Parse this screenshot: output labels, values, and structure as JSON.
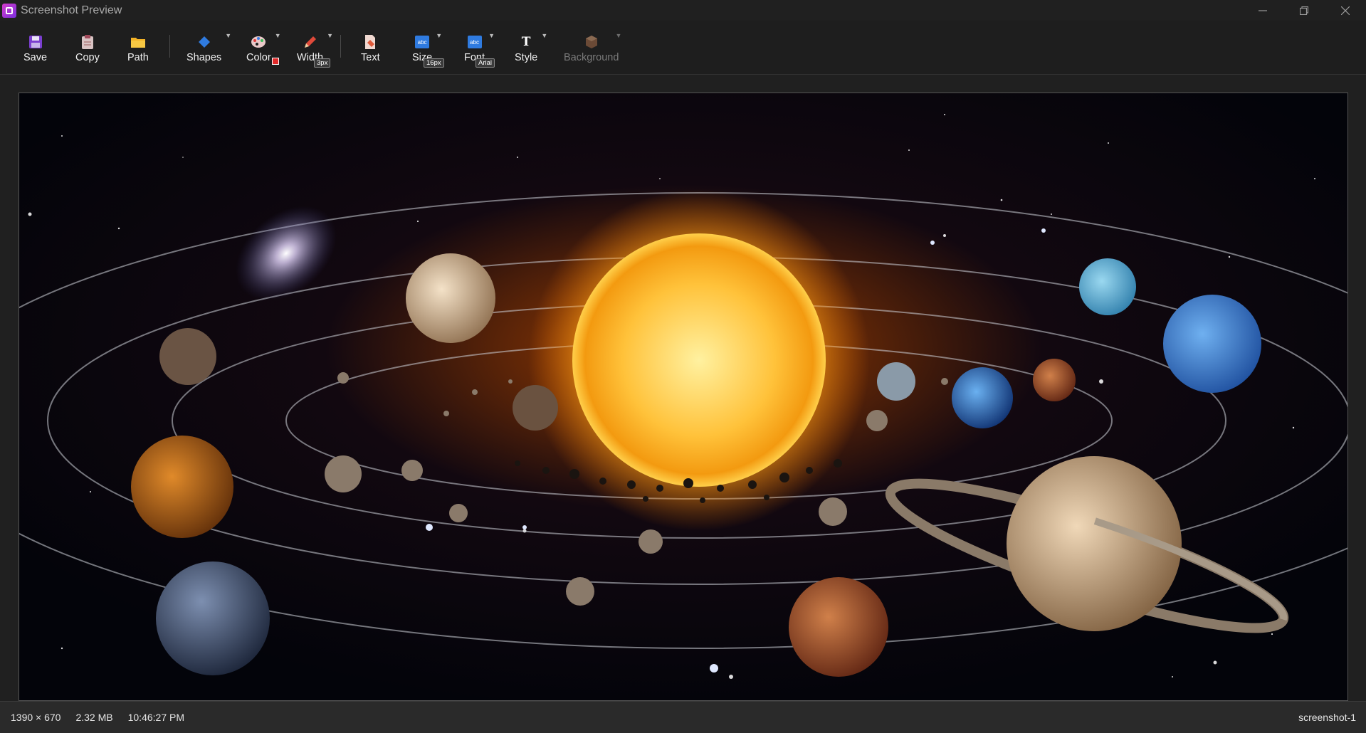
{
  "window": {
    "title": "Screenshot Preview",
    "controls": {
      "minimize": "minimize-icon",
      "restore": "restore-icon",
      "close": "close-icon"
    }
  },
  "toolbar": {
    "save": "Save",
    "copy": "Copy",
    "path": "Path",
    "shapes": "Shapes",
    "color": "Color",
    "width": "Width",
    "width_value": "3px",
    "text": "Text",
    "size": "Size",
    "size_value": "16px",
    "font": "Font",
    "font_value": "Arial",
    "style": "Style",
    "background": "Background",
    "size_icon_text": "abc",
    "font_icon_text": "abc",
    "style_icon_text": "T",
    "colors": {
      "accent": "#2f7be0",
      "selected_color": "#e22b2b"
    }
  },
  "status": {
    "dimensions": "1390 × 670",
    "file_size": "2.32 MB",
    "time": "10:46:27 PM",
    "name": "screenshot-1"
  }
}
